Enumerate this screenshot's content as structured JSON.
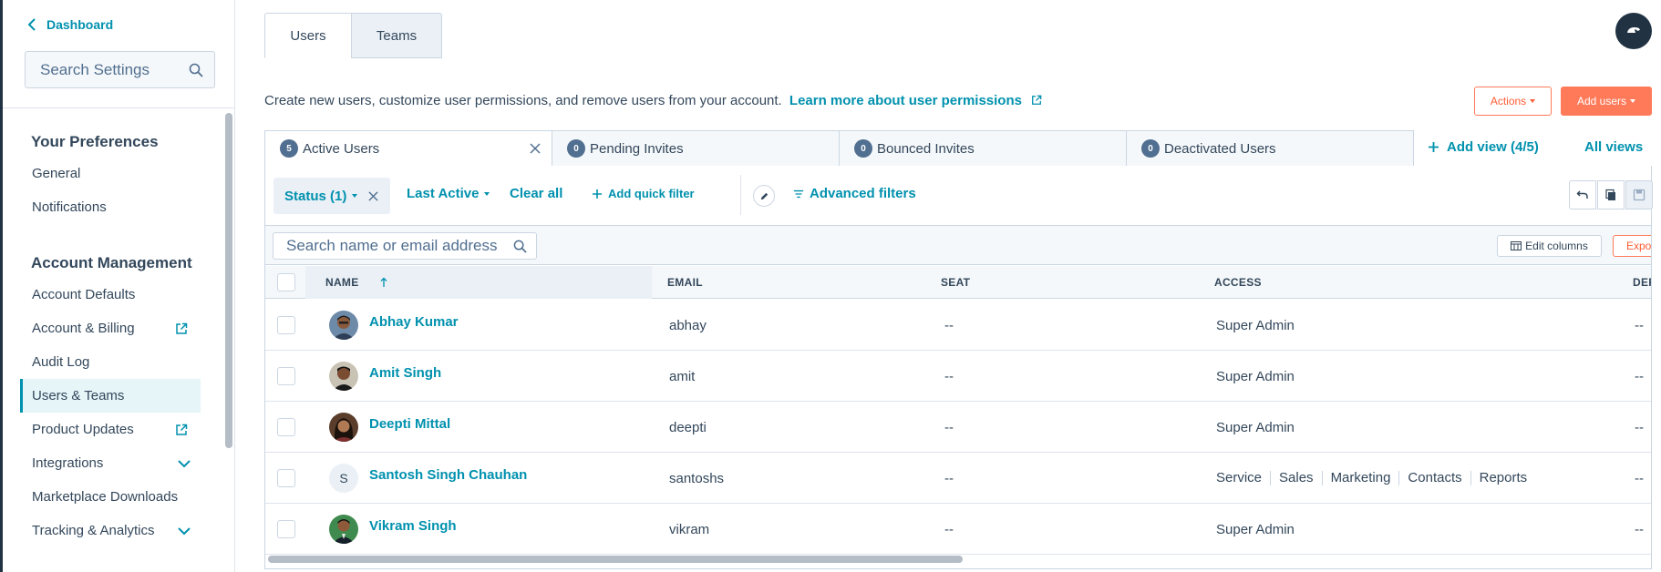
{
  "sidebar": {
    "back_label": "Dashboard",
    "search_placeholder": "Search Settings",
    "sections": {
      "preferences_title": "Your Preferences",
      "account_title": "Account Management"
    },
    "pref_items": [
      "General",
      "Notifications"
    ],
    "account_items": [
      {
        "label": "Account Defaults"
      },
      {
        "label": "Account & Billing",
        "icon": "external-link-icon"
      },
      {
        "label": "Audit Log"
      },
      {
        "label": "Users & Teams",
        "active": true
      },
      {
        "label": "Product Updates",
        "icon": "external-link-icon"
      },
      {
        "label": "Integrations",
        "icon": "chevron-down-icon"
      },
      {
        "label": "Marketplace Downloads"
      },
      {
        "label": "Tracking & Analytics",
        "icon": "chevron-down-icon"
      }
    ]
  },
  "header": {
    "tabs": [
      "Users",
      "Teams"
    ],
    "intro": "Create new users, customize user permissions, and remove users from your account.",
    "learn_more": "Learn more about user permissions",
    "actions_label": "Actions",
    "add_users_label": "Add users"
  },
  "views": {
    "tabs": [
      {
        "count": "5",
        "label": "Active Users"
      },
      {
        "count": "0",
        "label": "Pending Invites"
      },
      {
        "count": "0",
        "label": "Bounced Invites"
      },
      {
        "count": "0",
        "label": "Deactivated Users"
      }
    ],
    "add_view": "Add view (4/5)",
    "all_views": "All views"
  },
  "filters": {
    "status": "Status (1)",
    "last_active": "Last Active",
    "clear_all": "Clear all",
    "add_quick_filter": "Add quick filter",
    "advanced_filters": "Advanced filters"
  },
  "table": {
    "search_placeholder": "Search name or email address",
    "edit_columns": "Edit columns",
    "export_view": "Export view",
    "columns": {
      "name": "NAME",
      "email": "EMAIL",
      "seat": "SEAT",
      "access": "ACCESS",
      "default": "DEF"
    },
    "rows": [
      {
        "name": "Abhay Kumar",
        "email": "abhay",
        "seat": "--",
        "access": "Super Admin",
        "default": "--",
        "avatar": "photo"
      },
      {
        "name": "Amit Singh",
        "email": "amit",
        "seat": "--",
        "access": "Super Admin",
        "default": "--",
        "avatar": "photo"
      },
      {
        "name": "Deepti Mittal",
        "email": "deepti",
        "seat": "--",
        "access": "Super Admin",
        "default": "--",
        "avatar": "photo"
      },
      {
        "name": "Santosh Singh Chauhan",
        "email": "santoshs",
        "seat": "--",
        "access_tags": [
          "Service",
          "Sales",
          "Marketing",
          "Contacts",
          "Reports"
        ],
        "default": "--",
        "avatar_letter": "S"
      },
      {
        "name": "Vikram Singh",
        "email": "vikram",
        "seat": "--",
        "access": "Super Admin",
        "default": "--",
        "avatar": "photo"
      }
    ]
  },
  "colors": {
    "accent": "#0091ae",
    "brand_orange": "#ff7a59",
    "text": "#33475b",
    "border": "#cbd6e2"
  }
}
